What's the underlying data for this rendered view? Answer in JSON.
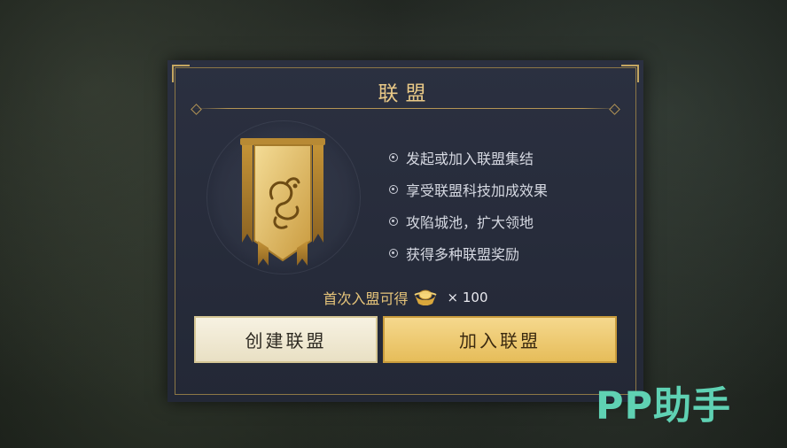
{
  "dialog": {
    "title": "联盟",
    "features": [
      "发起或加入联盟集结",
      "享受联盟科技加成效果",
      "攻陷城池，扩大领地",
      "获得多种联盟奖励"
    ],
    "reward": {
      "label": "首次入盟可得",
      "icon": "gold-ingot-icon",
      "quantity": "× 100"
    },
    "buttons": {
      "create": "创建联盟",
      "join": "加入联盟"
    }
  },
  "watermark": "PP助手",
  "colors": {
    "accent_gold": "#e9c987",
    "panel": "#262b3a",
    "join_button": "#f0cc70",
    "create_button": "#f3ecd6",
    "watermark": "#5fd1b3"
  }
}
